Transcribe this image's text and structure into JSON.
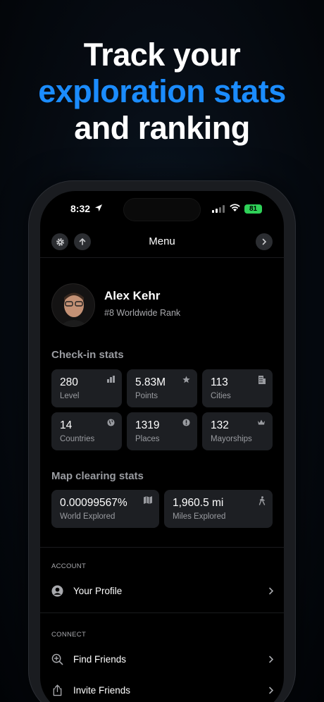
{
  "headline": {
    "line1": "Track your",
    "line2": "exploration stats",
    "line3": "and ranking"
  },
  "status_bar": {
    "time": "8:32",
    "battery": "81"
  },
  "nav": {
    "title": "Menu"
  },
  "profile": {
    "name": "Alex Kehr",
    "rank": "#8 Worldwide Rank"
  },
  "checkin": {
    "title": "Check-in stats",
    "cards": [
      {
        "value": "280",
        "label": "Level",
        "icon": "bar-chart-icon"
      },
      {
        "value": "5.83M",
        "label": "Points",
        "icon": "star-icon"
      },
      {
        "value": "113",
        "label": "Cities",
        "icon": "building-icon"
      },
      {
        "value": "14",
        "label": "Countries",
        "icon": "globe-icon"
      },
      {
        "value": "1319",
        "label": "Places",
        "icon": "info-icon"
      },
      {
        "value": "132",
        "label": "Mayorships",
        "icon": "crown-icon"
      }
    ]
  },
  "map_clearing": {
    "title": "Map clearing stats",
    "cards": [
      {
        "value": "0.00099567%",
        "label": "World Explored",
        "icon": "map-icon"
      },
      {
        "value": "1,960.5 mi",
        "label": "Miles Explored",
        "icon": "walking-icon"
      }
    ]
  },
  "account": {
    "label": "ACCOUNT",
    "items": [
      {
        "label": "Your Profile",
        "icon": "profile-icon"
      }
    ]
  },
  "connect": {
    "label": "CONNECT",
    "items": [
      {
        "label": "Find Friends",
        "icon": "search-plus-icon"
      },
      {
        "label": "Invite Friends",
        "icon": "share-icon"
      }
    ]
  },
  "colors": {
    "accent": "#1b8cff",
    "card": "#1d1f23",
    "battery": "#2fd158"
  }
}
